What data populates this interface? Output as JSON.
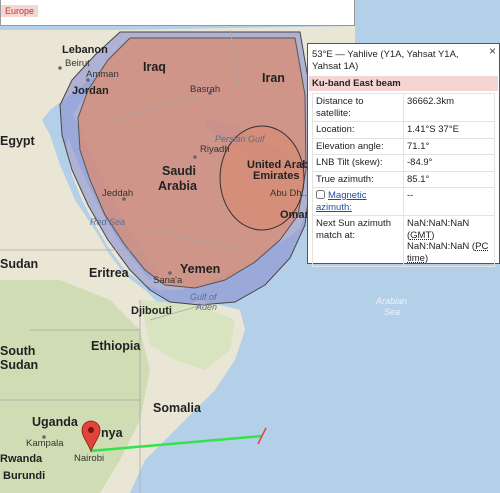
{
  "overlay": {
    "europe_label": "Europe"
  },
  "map": {
    "countries": {
      "lebanon": "Lebanon",
      "iraq": "Iraq",
      "iran": "Iran",
      "egypt": "Egypt",
      "saudi_1": "Saudi",
      "saudi_2": "Arabia",
      "uae_1": "United Arab",
      "uae_2": "Emirates",
      "sudan": "Sudan",
      "eritrea": "Eritrea",
      "yemen": "Yemen",
      "djibouti": "Djibouti",
      "ethiopia": "Ethiopia",
      "south_sudan_1": "South",
      "south_sudan_2": "Sudan",
      "somalia": "Somalia",
      "uganda": "Uganda",
      "kenya_partial": "nya",
      "rwanda": "Rwanda",
      "burundi": "Burundi",
      "oman_partial": "Oman"
    },
    "cities": {
      "beirut": "Beirut",
      "amman": "Amman",
      "jordan": "Jordan",
      "basrah": "Basrah",
      "riyadh": "Riyadh",
      "jeddah": "Jeddah",
      "sanaa": "Sana'a",
      "kampala": "Kampala",
      "nairobi": "Nairobi",
      "abu_dhabi": "Abu Dh..."
    },
    "water": {
      "persian_gulf": "Persian Gulf",
      "red_sea": "Red Sea",
      "gulf_of_aden_1": "Gulf of",
      "gulf_of_aden_2": "Aden",
      "arabian_sea_1": "Arabian",
      "arabian_sea_2": "Sea"
    }
  },
  "info_panel": {
    "title": "53°E — Yahlive (Y1A, Yahsat Y1A, Yahsat 1A)",
    "beam": "Ku-band East beam",
    "close_icon": "×",
    "rows": [
      {
        "key": "Distance to satellite:",
        "value": "36662.3km"
      },
      {
        "key": "Location:",
        "value": "1.41°S 37°E"
      },
      {
        "key": "Elevation angle:",
        "value": "71.1°"
      },
      {
        "key": "LNB Tilt (skew):",
        "value": "-84.9°"
      },
      {
        "key": "True azimuth:",
        "value": "85.1°"
      },
      {
        "key": "Magnetic azimuth:",
        "value": "--"
      }
    ],
    "next_sun": {
      "key": "Next Sun azimuth match at:",
      "gmt_value": "NaN:NaN:NaN",
      "gmt_label": "GMT",
      "pc_value": "NaN:NaN:NaN",
      "pc_label": "PC time"
    }
  },
  "colors": {
    "beam_fill": "#d98b6f",
    "beam_outer": "#8a8fd0",
    "line": "#34e34a",
    "marker": "#e0443a"
  }
}
